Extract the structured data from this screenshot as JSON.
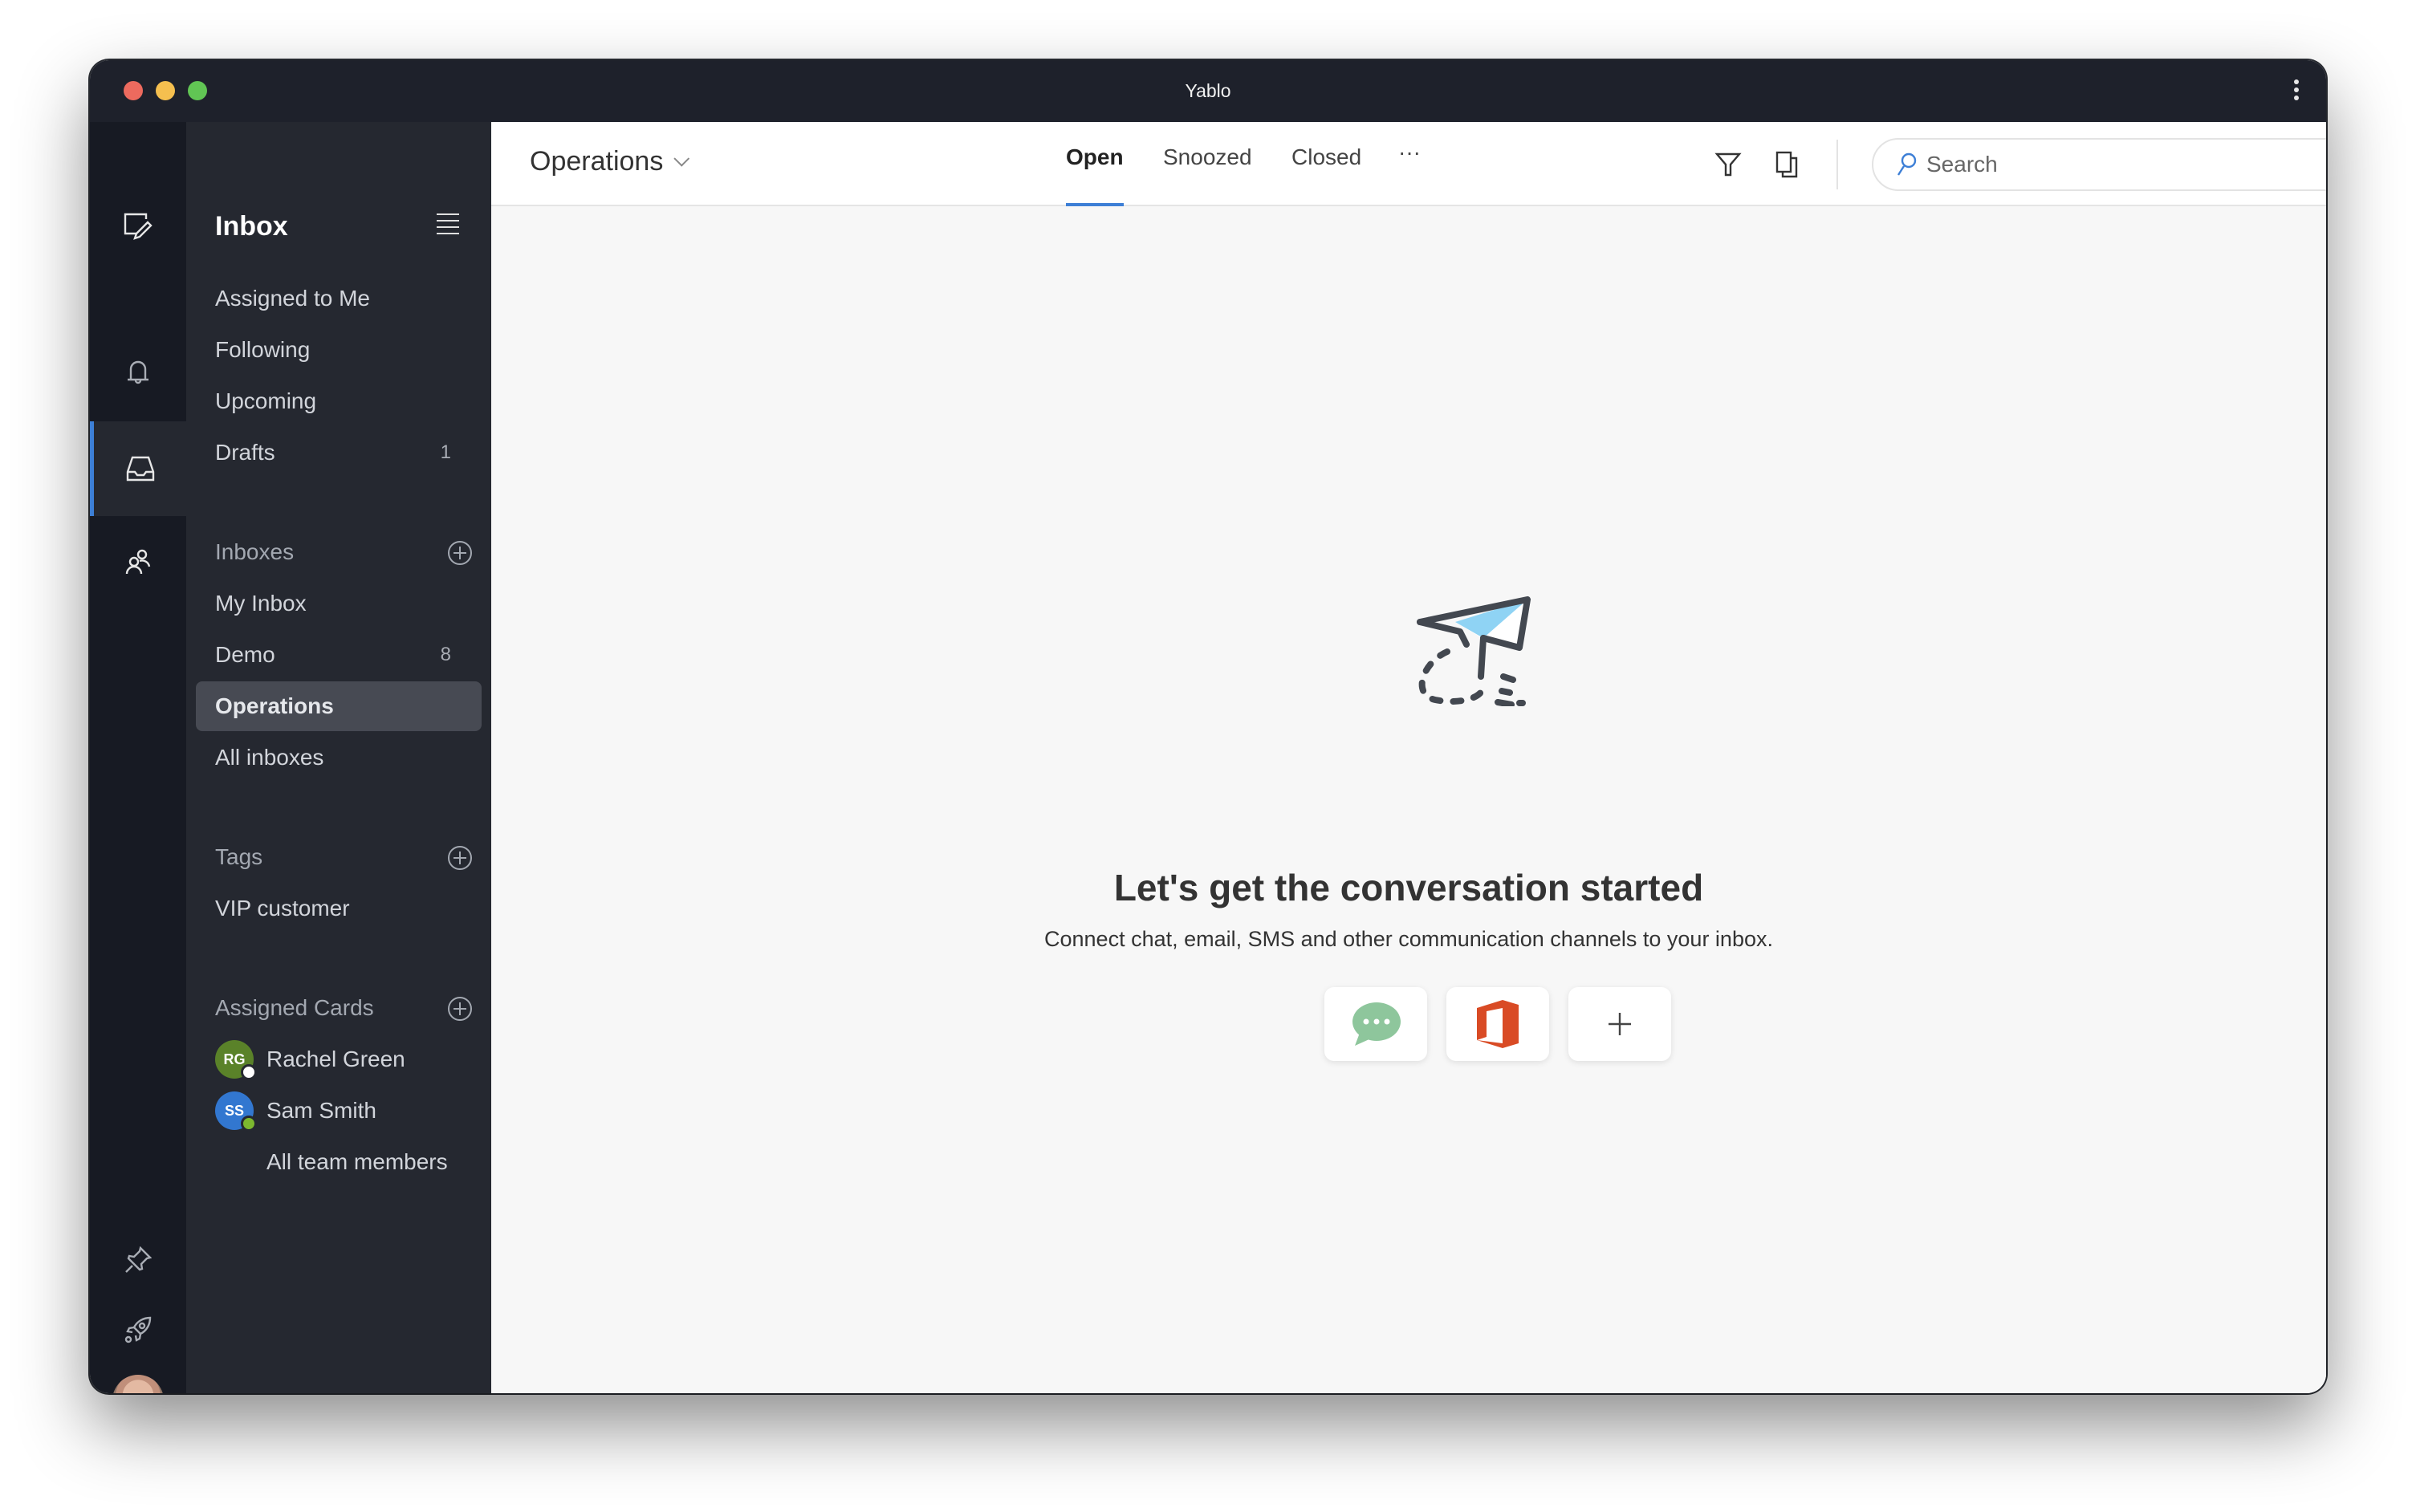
{
  "window": {
    "title": "Yablo",
    "menu_icon": "kebab-vertical-icon"
  },
  "rail": {
    "items": [
      {
        "name": "compose",
        "icon": "compose-icon"
      },
      {
        "name": "notifications",
        "icon": "bell-icon"
      },
      {
        "name": "inbox",
        "icon": "inbox-tray-icon",
        "active": true
      },
      {
        "name": "contacts",
        "icon": "people-icon"
      },
      {
        "name": "pinned",
        "icon": "pin-icon"
      },
      {
        "name": "launch",
        "icon": "rocket-icon"
      }
    ],
    "user_status": "online",
    "accent_color": "#3d7fd6"
  },
  "nav": {
    "title": "Inbox",
    "views": [
      {
        "label": "Assigned to Me"
      },
      {
        "label": "Following"
      },
      {
        "label": "Upcoming"
      },
      {
        "label": "Drafts",
        "count": "1"
      }
    ],
    "inboxes_header": "Inboxes",
    "inboxes": [
      {
        "label": "My Inbox"
      },
      {
        "label": "Demo",
        "count": "8"
      },
      {
        "label": "Operations",
        "selected": true
      },
      {
        "label": "All inboxes"
      }
    ],
    "tags_header": "Tags",
    "tags": [
      {
        "label": "VIP customer"
      }
    ],
    "assigned_header": "Assigned Cards",
    "members": [
      {
        "initials": "RG",
        "name": "Rachel Green",
        "color": "#5a8229",
        "presence": "away",
        "presence_color": "#ffffff"
      },
      {
        "initials": "SS",
        "name": "Sam Smith",
        "color": "#3277d0",
        "presence": "online",
        "presence_color": "#7cb82f"
      }
    ],
    "all_members_label": "All team members"
  },
  "header": {
    "inbox_name": "Operations",
    "tabs": [
      {
        "label": "Open",
        "active": true
      },
      {
        "label": "Snoozed"
      },
      {
        "label": "Closed"
      },
      {
        "label": "···"
      }
    ],
    "filter_icon": "filter-icon",
    "copy_icon": "copy-icon",
    "search": {
      "placeholder": "Search",
      "value": ""
    }
  },
  "empty_state": {
    "title": "Let's get the conversation started",
    "subtitle": "Connect chat, email, SMS and other communication channels to your inbox.",
    "channels": [
      {
        "name": "chat",
        "icon": "chat-bubble-icon",
        "color": "#8ec69c"
      },
      {
        "name": "office365",
        "icon": "office-icon",
        "color": "#d94b25"
      },
      {
        "name": "add",
        "icon": "plus-icon",
        "color": "#444444"
      }
    ]
  }
}
